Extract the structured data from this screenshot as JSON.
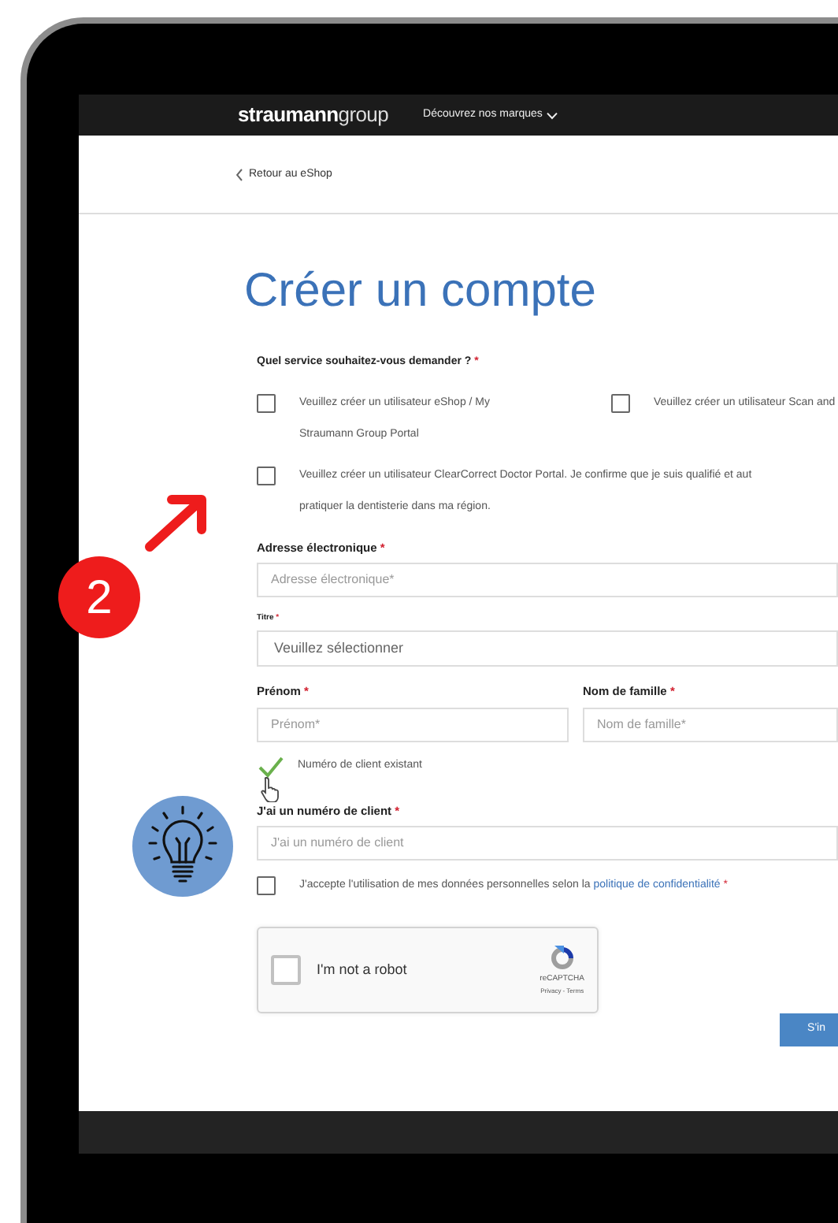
{
  "header": {
    "logo_bold": "straumann",
    "logo_light": "group",
    "menu": "Découvrez nos marques"
  },
  "back_link": "Retour au eShop",
  "title": "Créer un compte",
  "service": {
    "label": "Quel service souhaitez-vous demander ?",
    "required_mark": "*",
    "options": [
      {
        "lines": [
          "Veuillez créer un utilisateur eShop / My",
          "Straumann Group Portal"
        ],
        "checked": false
      },
      {
        "lines": [
          "Veuillez créer un utilisateur Scan and"
        ],
        "checked": false
      },
      {
        "lines": [
          "Veuillez créer un utilisateur ClearCorrect Doctor Portal. Je confirme que je suis qualifié et aut",
          "pratiquer la dentisterie dans ma région."
        ],
        "checked": false
      }
    ]
  },
  "email": {
    "label": "Adresse électronique",
    "required_mark": "*",
    "placeholder": "Adresse électronique*"
  },
  "salutation": {
    "label": "Titre",
    "required_mark": "*",
    "value": "Veuillez sélectionner"
  },
  "first_name": {
    "label": "Prénom",
    "required_mark": "*",
    "placeholder": "Prénom*"
  },
  "last_name": {
    "label": "Nom de famille",
    "required_mark": "*",
    "placeholder": "Nom de famille*"
  },
  "existing_client": {
    "label": "Numéro de client existant",
    "checked": true
  },
  "client_number": {
    "label": "J'ai un numéro de client",
    "required_mark": "*",
    "placeholder": "J'ai un numéro de client"
  },
  "consent": {
    "text": "J'accepte l'utilisation de mes données personnelles selon la",
    "link": "politique de confidentialité",
    "required_mark": "*",
    "checked": false
  },
  "captcha": {
    "label": "I'm not a robot",
    "checked": false,
    "brand": "reCAPTCHA",
    "links": "Privacy - Terms"
  },
  "submit": "S'in",
  "annotation": {
    "step": "2"
  }
}
